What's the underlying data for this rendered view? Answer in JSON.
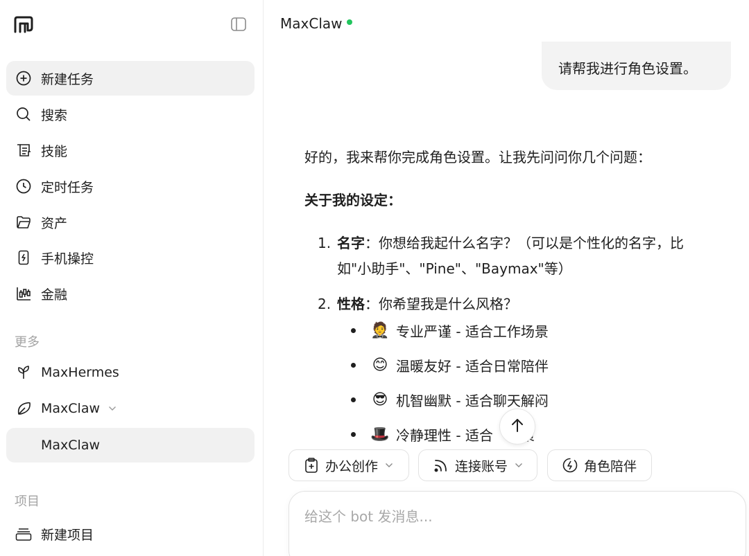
{
  "sidebar": {
    "items": [
      {
        "label": "新建任务",
        "icon": "plus-circle-icon"
      },
      {
        "label": "搜索",
        "icon": "search-icon"
      },
      {
        "label": "技能",
        "icon": "scroll-icon"
      },
      {
        "label": "定时任务",
        "icon": "clock-icon"
      },
      {
        "label": "资产",
        "icon": "folder-icon"
      },
      {
        "label": "手机操控",
        "icon": "phone-icon"
      },
      {
        "label": "金融",
        "icon": "candlestick-icon"
      }
    ],
    "more_label": "更多",
    "more_items": [
      {
        "label": "MaxHermes",
        "icon": "sprout-icon"
      },
      {
        "label": "MaxClaw",
        "icon": "leaf-icon"
      },
      {
        "label": "MaxClaw"
      }
    ],
    "projects_label": "项目",
    "project_items": [
      {
        "label": "新建项目",
        "icon": "stack-icon"
      }
    ]
  },
  "header": {
    "title": "MaxClaw",
    "status_color": "#22c55e"
  },
  "chat": {
    "user_message": "请帮我进行角色设置。",
    "assistant": {
      "intro": "好的，我来帮你完成角色设置。让我先问问你几个问题：",
      "section_title": "关于我的设定：",
      "q1_num": "1.",
      "q1_key": "名字",
      "q1_text_line1": "：你想给我起什么名字？（可以是个性化的名字，比",
      "q1_text_line2": "如\"小助手\"、\"Pine\"、\"Baymax\"等）",
      "q2_num": "2.",
      "q2_key": "性格",
      "q2_text": "：你希望我是什么风格？",
      "styles": [
        {
          "emoji": "🤵",
          "text": "专业严谨 - 适合工作场景"
        },
        {
          "emoji": "😊",
          "text": "温暖友好 - 适合日常陪伴"
        },
        {
          "emoji": "😎",
          "text": "机智幽默 - 适合聊天解闷"
        },
        {
          "emoji": "🎩",
          "text": "冷静理性 - 适合　决策"
        }
      ]
    }
  },
  "quick_actions": [
    {
      "label": "办公创作",
      "icon": "office-icon",
      "dropdown": true
    },
    {
      "label": "连接账号",
      "icon": "rss-icon",
      "dropdown": true
    },
    {
      "label": "角色陪伴",
      "icon": "bolt-icon",
      "dropdown": false
    }
  ],
  "composer": {
    "placeholder": "给这个 bot 发消息..."
  }
}
